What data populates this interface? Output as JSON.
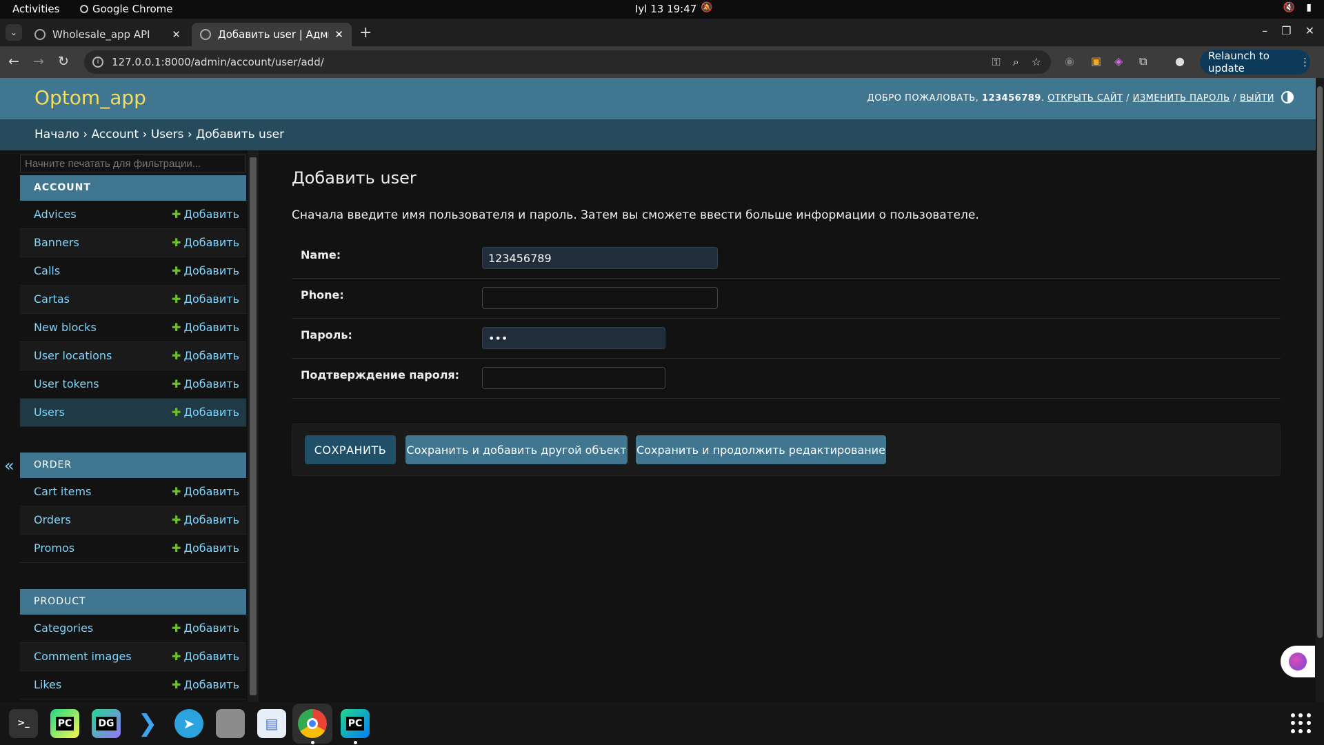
{
  "topbar": {
    "activities": "Activities",
    "app_name": "Google Chrome",
    "clock": "Iyl 13  19:47"
  },
  "browser": {
    "tabs": [
      {
        "title": "Wholesale_app API"
      },
      {
        "title": "Добавить user | Админи"
      }
    ],
    "url": "127.0.0.1:8000/admin/account/user/add/",
    "relaunch_label": "Relaunch to update"
  },
  "header": {
    "branding": "Optom_app",
    "welcome": "ДОБРО ПОЖАЛОВАТЬ,",
    "username": "123456789",
    "view_site": "ОТКРЫТЬ САЙТ",
    "change_password": "ИЗМЕНИТЬ ПАРОЛЬ",
    "logout": "ВЫЙТИ",
    "sep": "/"
  },
  "breadcrumbs": {
    "home": "Начало",
    "app": "Account",
    "model": "Users",
    "current": "Добавить user",
    "sep": "›"
  },
  "sidebar": {
    "filter_placeholder": "Начните печатать для фильтрации...",
    "add_label": "Добавить",
    "sections": [
      {
        "caption": "ACCOUNT",
        "items": [
          "Advices",
          "Banners",
          "Calls",
          "Cartas",
          "New blocks",
          "User locations",
          "User tokens",
          "Users"
        ]
      },
      {
        "caption": "ORDER",
        "items": [
          "Cart items",
          "Orders",
          "Promos"
        ]
      },
      {
        "caption": "PRODUCT",
        "items": [
          "Categories",
          "Comment images",
          "Likes"
        ]
      }
    ]
  },
  "content": {
    "title": "Добавить user",
    "intro": "Сначала введите имя пользователя и пароль. Затем вы сможете ввести больше информации о пользователе.",
    "fields": [
      {
        "label": "Name:",
        "value": "123456789"
      },
      {
        "label": "Phone:",
        "value": ""
      },
      {
        "label": "Пароль:",
        "value": "•••"
      },
      {
        "label": "Подтверждение пароля:",
        "value": ""
      }
    ],
    "buttons": {
      "save": "СОХРАНИТЬ",
      "save_add": "Сохранить и добавить другой объект",
      "save_continue": "Сохранить и продолжить редактирование"
    }
  },
  "dock": {
    "apps": [
      "terminal-icon",
      "pycharm-icon",
      "datagrip-icon",
      "vscode-icon",
      "telegram-icon",
      "files-icon",
      "text-editor-icon",
      "chrome-icon",
      "pycharm-ce-icon"
    ],
    "labels": {
      "terminal": ">_",
      "pycharm": "PC",
      "datagrip": "DG",
      "pycharm_ce": "PC"
    }
  }
}
